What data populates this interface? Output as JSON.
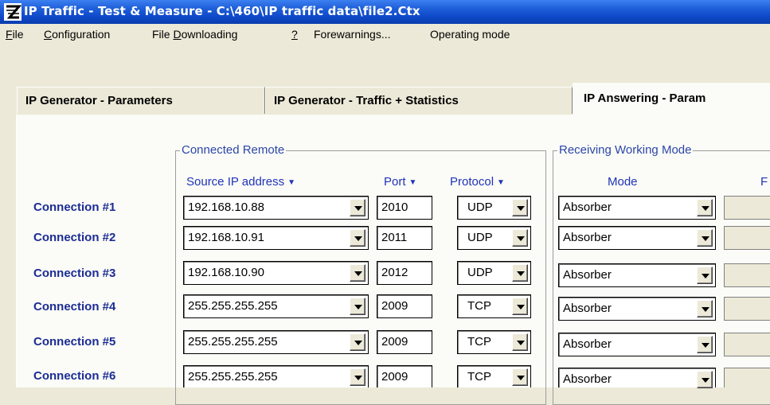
{
  "window": {
    "title": "IP Traffic - Test & Measure - C:\\460\\IP traffic data\\file2.Ctx",
    "icon": "app-logo-icon"
  },
  "menu": {
    "file": "File",
    "configuration": "Configuration",
    "file_downloading": "File Downloading",
    "help": "?",
    "forewarnings": "Forewarnings...",
    "operating_mode": "Operating mode"
  },
  "tabs": [
    {
      "label": "IP Generator - Parameters",
      "active": false
    },
    {
      "label": "IP Generator - Traffic + Statistics",
      "active": false
    },
    {
      "label": "IP Answering - Param",
      "active": true
    }
  ],
  "groups": {
    "connected_remote": "Connected Remote",
    "receiving_working_mode": "Receiving Working Mode"
  },
  "columns": {
    "source_ip": "Source IP address",
    "port": "Port",
    "protocol": "Protocol",
    "mode": "Mode",
    "cut": "F"
  },
  "connections": [
    {
      "label": "Connection #1",
      "ip": "192.168.10.88",
      "port": "2010",
      "protocol": "UDP",
      "mode": "Absorber"
    },
    {
      "label": "Connection #2",
      "ip": "192.168.10.91",
      "port": "2011",
      "protocol": "UDP",
      "mode": "Absorber"
    },
    {
      "label": "Connection #3",
      "ip": "192.168.10.90",
      "port": "2012",
      "protocol": "UDP",
      "mode": "Absorber"
    },
    {
      "label": "Connection #4",
      "ip": "255.255.255.255",
      "port": "2009",
      "protocol": "TCP",
      "mode": "Absorber"
    },
    {
      "label": "Connection #5",
      "ip": "255.255.255.255",
      "port": "2009",
      "protocol": "TCP",
      "mode": "Absorber"
    },
    {
      "label": "Connection #6",
      "ip": "255.255.255.255",
      "port": "2009",
      "protocol": "TCP",
      "mode": "Absorber"
    }
  ],
  "colors": {
    "titlebar": "#0b3cad",
    "header_text": "#1f33b8",
    "connection_label": "#1b2c94"
  }
}
